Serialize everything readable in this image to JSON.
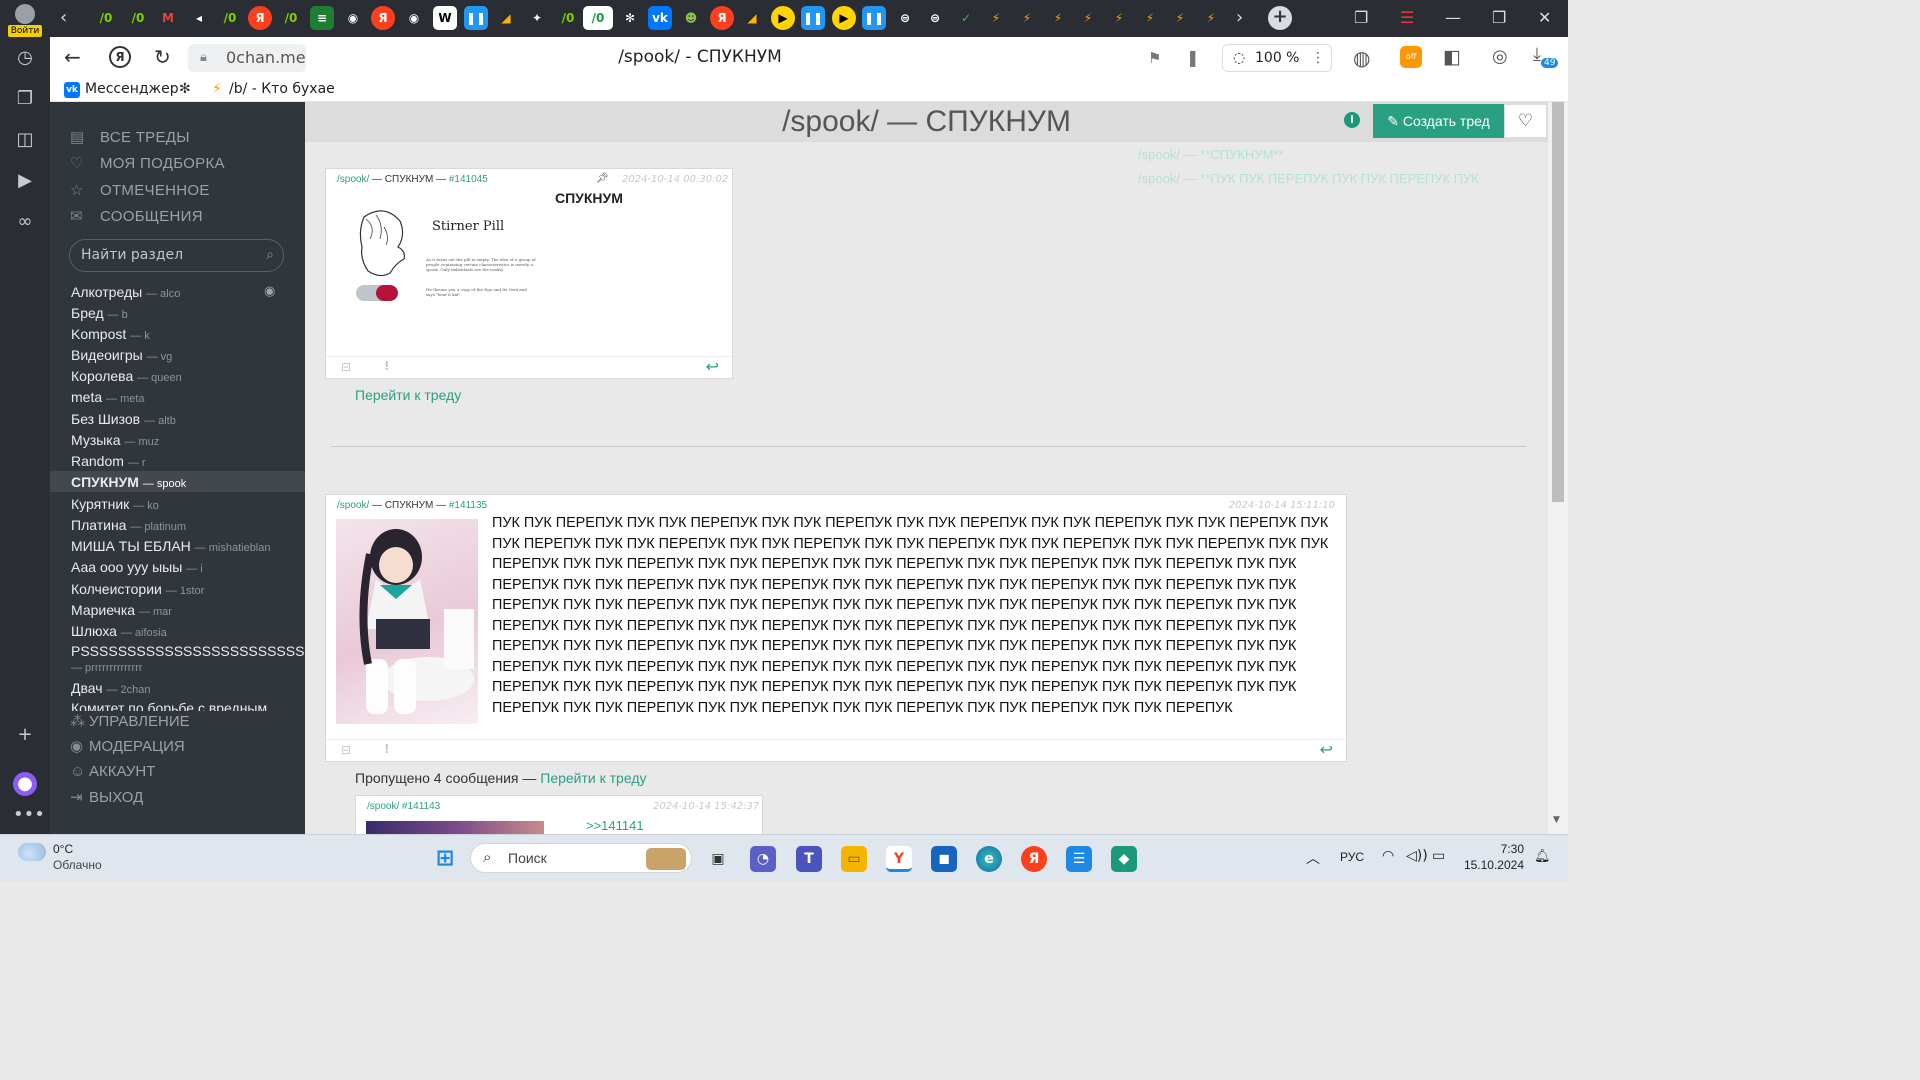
{
  "browser": {
    "login_label": "Войти",
    "url": "0chan.me",
    "page_title": "/spook/ - СПУКНУМ",
    "zoom": "100 %",
    "downloads_badge": "49",
    "bookmarks": [
      {
        "label": "Мессенджер"
      },
      {
        "label": "/b/ - Кто бухает в"
      }
    ]
  },
  "sidebar": {
    "nav": [
      {
        "label": "ВСЕ ТРЕДЫ",
        "icon": "list-icon"
      },
      {
        "label": "МОЯ ПОДБОРКА",
        "icon": "heart-icon"
      },
      {
        "label": "ОТМЕЧЕННОЕ",
        "icon": "star-icon"
      },
      {
        "label": "СООБЩЕНИЯ",
        "icon": "mail-icon"
      }
    ],
    "search_placeholder": "Найти раздел",
    "boards": [
      {
        "name": "Алкотреды",
        "code": "— alco"
      },
      {
        "name": "Бред",
        "code": "— b"
      },
      {
        "name": "Kompost",
        "code": "— k"
      },
      {
        "name": "Видеоигры",
        "code": "— vg"
      },
      {
        "name": "Королева",
        "code": "— queen"
      },
      {
        "name": "meta",
        "code": "— meta"
      },
      {
        "name": "Без Шизов",
        "code": "— altb"
      },
      {
        "name": "Музыка",
        "code": "— muz"
      },
      {
        "name": "Random",
        "code": "— r"
      },
      {
        "name": "СПУКНУМ",
        "code": "— spook"
      },
      {
        "name": "Курятник",
        "code": "— ko"
      },
      {
        "name": "Платина",
        "code": "— platinum"
      },
      {
        "name": "МИША ТЫ ЕБЛАН",
        "code": "— mishatieblan"
      },
      {
        "name": "Ааа ооо ууу ыыы",
        "code": "— i"
      },
      {
        "name": "Колчеистории",
        "code": "— 1stor"
      },
      {
        "name": "Мариечка",
        "code": "— mar"
      },
      {
        "name": "Шлюха",
        "code": "— aifosia"
      },
      {
        "name": "PSSSSSSSSSSSSSSSSSSSSSSSSSSSSSS",
        "code": "— prrrrrrrrrrrrrr"
      },
      {
        "name": "Двач",
        "code": "— 2chan"
      },
      {
        "name": "Комитет по борьбе с вредным",
        "code": ""
      }
    ],
    "management": [
      {
        "label": "УПРАВЛЕНИЕ"
      },
      {
        "label": "МОДЕРАЦИЯ"
      },
      {
        "label": "АККАУНТ"
      },
      {
        "label": "ВЫХОД"
      }
    ]
  },
  "main": {
    "board_title": "/spook/ — СПУКНУМ",
    "create_thread": "Создать тред",
    "recent_threads": [
      "/spook/ — **СПУКНУМ**",
      "/spook/ — **ПУК ПУК ПЕРЕПУК ПУК ПУК ПЕРЕПУК ПУК"
    ],
    "posts": [
      {
        "board": "/spook/",
        "board_name": "— СПУКНУМ —",
        "id": "#141045",
        "date": "2024-10-14 00:30:02",
        "subject": "СПУКНУМ",
        "image_title": "Stirner Pill",
        "image_caption_1": "As it turns out the pill is empty. The idea of a group of people containing certain characteristics is merely a spook. Only individuals are the reality.",
        "image_caption_2": "He throws you a copy of the Ego and Its Own and says \"beat it kid\".",
        "goto": "Перейти к треду"
      },
      {
        "board": "/spook/",
        "board_name": "— СПУКНУМ —",
        "id": "#141135",
        "date": "2024-10-14 15:11:10",
        "body": "ПУК ПУК ПЕРЕПУК ПУК ПУК ПЕРЕПУК ПУК ПУК ПЕРЕПУК ПУК ПУК ПЕРЕПУК ПУК ПУК ПЕРЕПУК ПУК ПУК ПЕРЕПУК ПУК ПУК ПЕРЕПУК ПУК ПУК ПЕРЕПУК ПУК ПУК ПЕРЕПУК ПУК ПУК ПЕРЕПУК ПУК ПУК ПЕРЕПУК ПУК ПУК ПЕРЕПУК ПУК ПУК ПЕРЕПУК ПУК ПУК ПЕРЕПУК ПУК ПУК ПЕРЕПУК ПУК ПУК ПЕРЕПУК ПУК ПУК ПЕРЕПУК ПУК ПУК ПЕРЕПУК ПУК ПУК ПЕРЕПУК ПУК ПУК ПЕРЕПУК ПУК ПУК ПЕРЕПУК ПУК ПУК ПЕРЕПУК ПУК ПУК ПЕРЕПУК ПУК ПУК ПЕРЕПУК ПУК ПУК ПЕРЕПУК ПУК ПУК ПЕРЕПУК ПУК ПУК ПЕРЕПУК ПУК ПУК ПЕРЕПУК ПУК ПУК ПЕРЕПУК ПУК ПУК ПЕРЕПУК ПУК ПУК ПЕРЕПУК ПУК ПУК ПЕРЕПУК ПУК ПУК ПЕРЕПУК ПУК ПУК ПЕРЕПУК ПУК ПУК ПЕРЕПУК ПУК ПУК ПЕРЕПУК ПУК ПУК ПЕРЕПУК ПУК ПУК ПЕРЕПУК ПУК ПУК ПЕРЕПУК ПУК ПУК ПЕРЕПУК ПУК ПУК ПЕРЕПУК ПУК ПУК ПЕРЕПУК ПУК ПУК ПЕРЕПУК ПУК ПУК ПЕРЕПУК ПУК ПУК ПЕРЕПУК ПУК ПУК ПЕРЕПУК ПУК ПУК ПЕРЕПУК ПУК ПУК ПЕРЕПУК ПУК ПУК ПЕРЕПУК ПУК ПУК ПЕРЕПУК ПУК ПУК ПЕРЕПУК ПУК ПУК ПЕРЕПУК ПУК ПУК ПЕРЕПУК ПУК ПУК ПЕРЕПУК ПУК ПУК ПЕРЕПУК ПУК ПУК ПЕРЕПУК ПУК ПУК ПЕРЕПУК ПУК ПУК ПЕРЕПУК ПУК ПУК ПЕРЕПУК ПУК ПУК ПЕРЕПУК",
        "skipped": "Пропущено 4 сообщения —",
        "goto": "Перейти к треду"
      },
      {
        "board": "/spook/",
        "id": "#141143",
        "date": "2024-10-14 15:42:37",
        "reply": ">>141141"
      }
    ]
  },
  "taskbar": {
    "weather_temp": "0°C",
    "weather_desc": "Облачно",
    "search_placeholder": "Поиск",
    "lang": "РУС",
    "time": "7:30",
    "date": "15.10.2024"
  },
  "colors": {
    "accent": "#2aa083",
    "sidebar": "#31353c",
    "browser_dark": "#2a2d33"
  }
}
